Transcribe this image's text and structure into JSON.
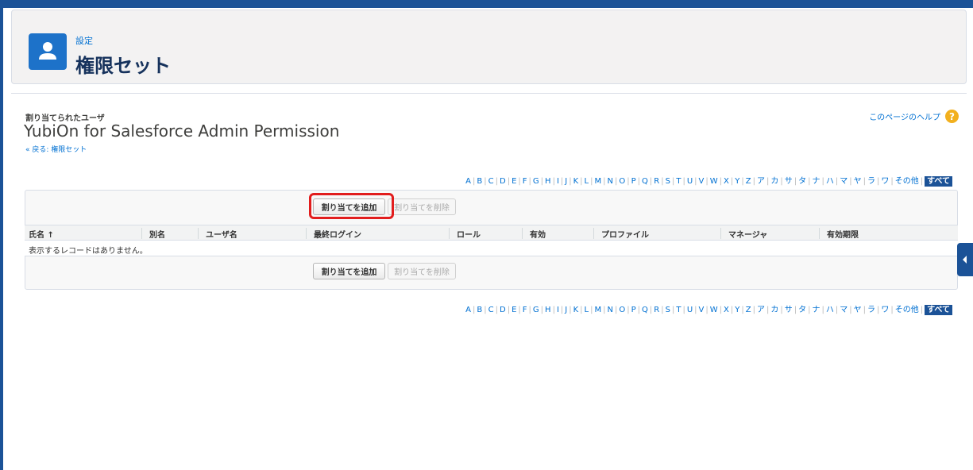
{
  "header": {
    "breadcrumb": "設定",
    "title": "権限セット",
    "icon": "user-icon"
  },
  "record": {
    "section_label": "割り当てられたユーザ",
    "title": "YubiOn for Salesforce Admin Permission",
    "back_link": "« 戻る: 権限セット"
  },
  "help": {
    "label": "このページのヘルプ",
    "icon": "help-icon"
  },
  "alphabet": [
    "A",
    "B",
    "C",
    "D",
    "E",
    "F",
    "G",
    "H",
    "I",
    "J",
    "K",
    "L",
    "M",
    "N",
    "O",
    "P",
    "Q",
    "R",
    "S",
    "T",
    "U",
    "V",
    "W",
    "X",
    "Y",
    "Z",
    "ア",
    "カ",
    "サ",
    "タ",
    "ナ",
    "ハ",
    "マ",
    "ヤ",
    "ラ",
    "ワ",
    "その他",
    "すべて"
  ],
  "alphabet_active": "すべて",
  "buttons": {
    "add": "割り当てを追加",
    "remove": "割り当てを削除"
  },
  "table": {
    "columns": [
      "氏名 ↑",
      "別名",
      "ユーザ名",
      "最終ログイン",
      "ロール",
      "有効",
      "プロファイル",
      "マネージャ",
      "有効期限"
    ],
    "empty_message": "表示するレコードはありません。"
  },
  "colors": {
    "accent": "#1b5297",
    "link": "#0070d2",
    "highlight": "#e21d1d",
    "help": "#f2b01e"
  }
}
